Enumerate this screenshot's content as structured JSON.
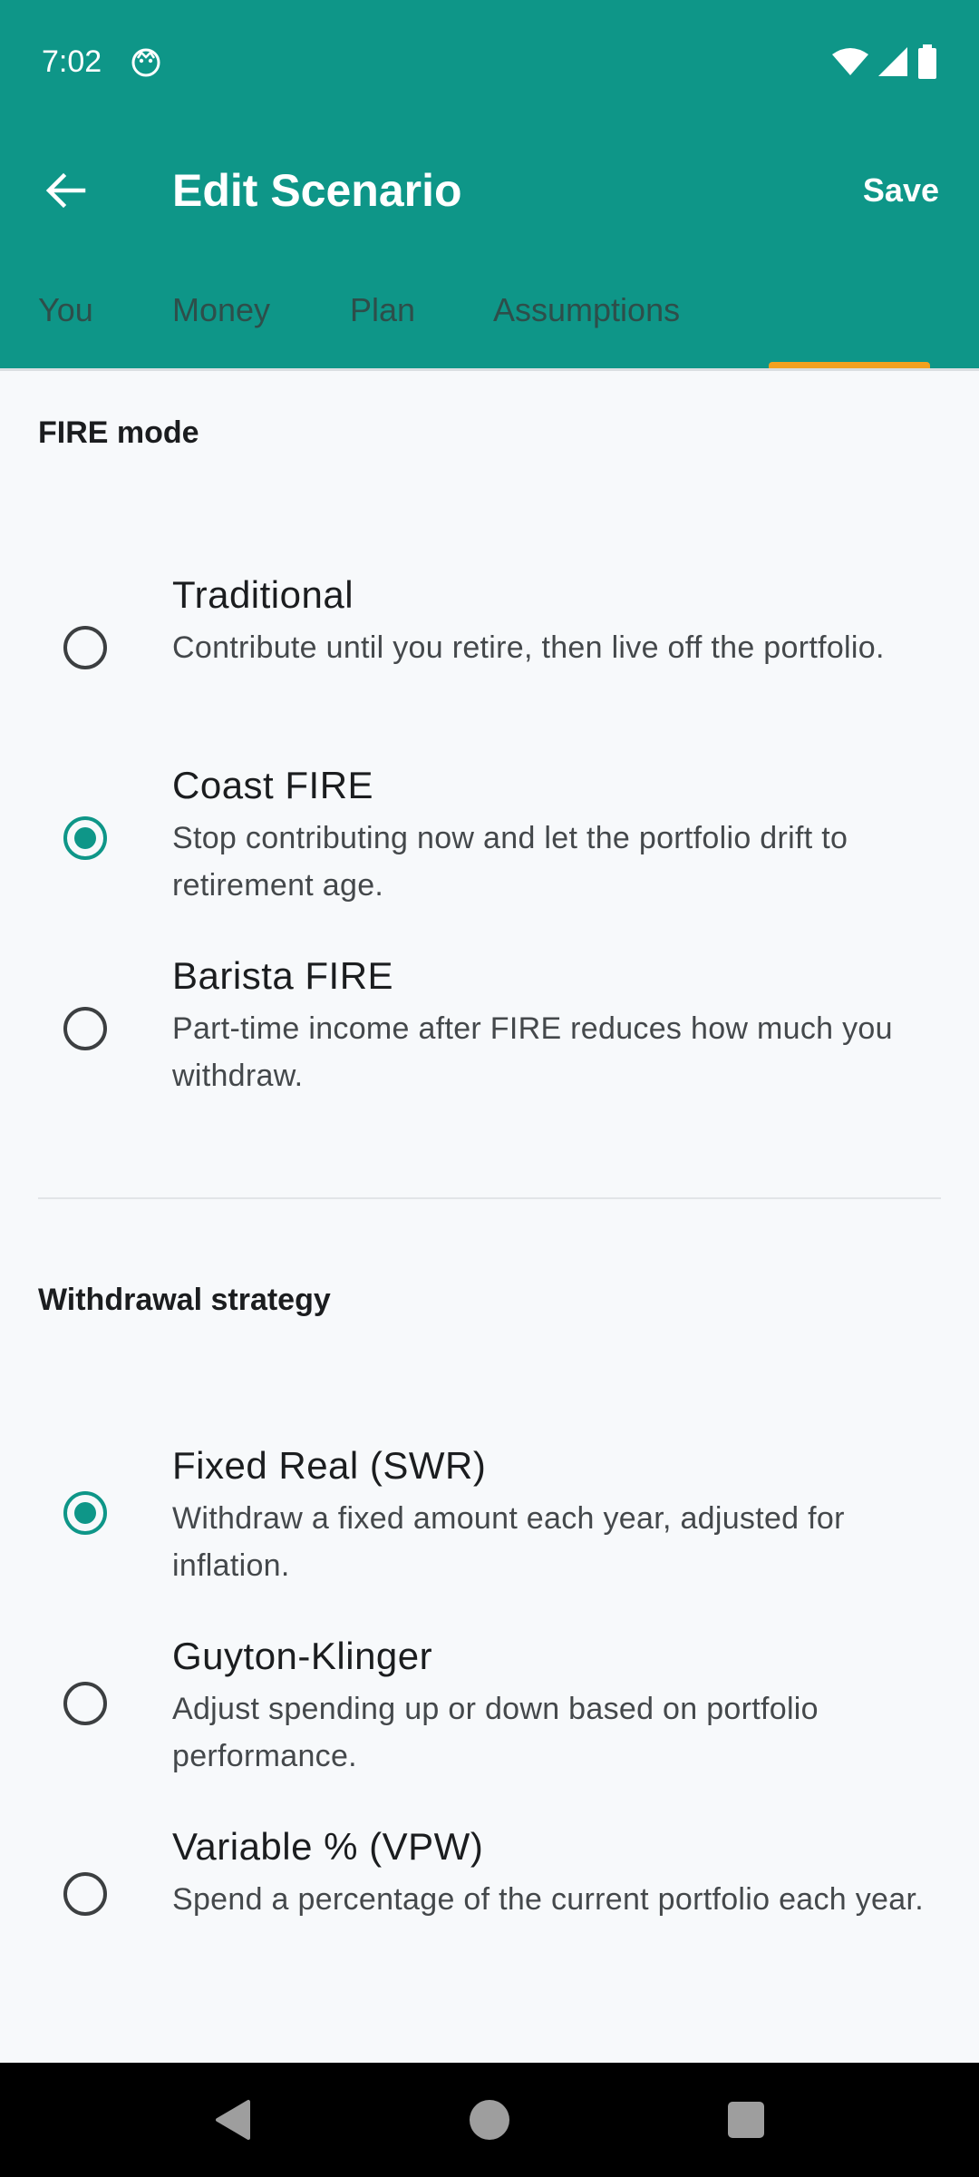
{
  "status_bar": {
    "time": "7:02"
  },
  "toolbar": {
    "title": "Edit Scenario",
    "save_label": "Save"
  },
  "tabs": [
    {
      "label": "You"
    },
    {
      "label": "Money"
    },
    {
      "label": "Plan"
    },
    {
      "label": "Assumptions"
    }
  ],
  "fire_mode": {
    "title": "FIRE mode",
    "options": [
      {
        "title": "Traditional",
        "description": "Contribute until you retire, then live off the portfolio.",
        "selected": false
      },
      {
        "title": "Coast FIRE",
        "description": "Stop contributing now and let the portfolio drift to retirement age.",
        "selected": true
      },
      {
        "title": "Barista FIRE",
        "description": "Part-time income after FIRE reduces how much you withdraw.",
        "selected": false
      }
    ]
  },
  "withdrawal": {
    "title": "Withdrawal strategy",
    "options": [
      {
        "title": "Fixed Real (SWR)",
        "description": "Withdraw a fixed amount each year, adjusted for inflation.",
        "selected": true
      },
      {
        "title": "Guyton-Klinger",
        "description": "Adjust spending up or down based on portfolio performance.",
        "selected": false
      },
      {
        "title": "Variable % (VPW)",
        "description": "Spend a percentage of the current portfolio each year.",
        "selected": false
      }
    ]
  },
  "colors": {
    "primary": "#0E9688",
    "tab_indicator": "#F2A11F",
    "background": "#F7F9FB"
  }
}
